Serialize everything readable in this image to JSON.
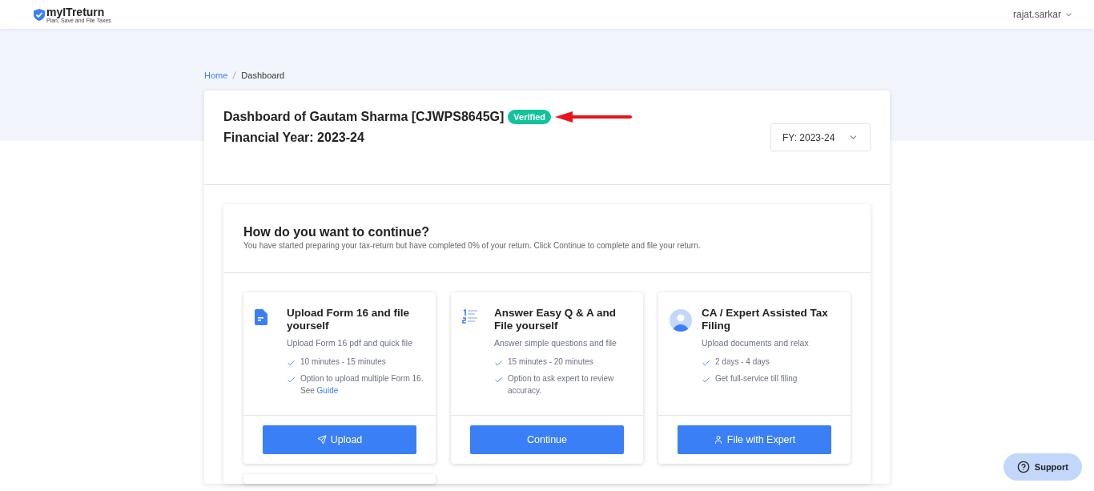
{
  "header": {
    "logo": {
      "name": "myITreturn",
      "tagline": "Plan, Save and File Taxes"
    },
    "user": "rajat.sarkar"
  },
  "breadcrumb": [
    {
      "label": "Home",
      "selected": false
    },
    {
      "label": "Dashboard",
      "selected": true
    }
  ],
  "dashboard": {
    "title": "Dashboard of Gautam Sharma [CJWPS8645G]",
    "badge": "Verified",
    "subtitle": "Financial Year: 2023-24",
    "year_select": "FY: 2023-24"
  },
  "continue": {
    "title": "How do you want to continue?",
    "text": "You have started preparing your tax-return but have completed 0% of your return. Click Continue to complete and file your return.",
    "options": [
      {
        "kind": "document",
        "title": "Upload Form 16 and file yourself",
        "text": "Upload Form 16 pdf and quick file",
        "features": [
          {
            "text": "10 minutes - 15 minutes"
          },
          {
            "text": "Option to upload multiple Form 16. See ",
            "link": "Guide"
          }
        ],
        "button": {
          "label": "Upload",
          "kind": "send"
        }
      },
      {
        "kind": "list",
        "title": "Answer Easy Q & A and File yourself",
        "text": "Answer simple questions and file",
        "features": [
          {
            "text": "15 minutes - 20 minutes"
          },
          {
            "text": "Option to ask expert to review accuracy."
          }
        ],
        "button": {
          "label": "Continue",
          "kind": "plain"
        }
      },
      {
        "kind": "person",
        "title": "CA / Expert Assisted Tax Filing",
        "text": "Upload documents and relax",
        "features": [
          {
            "text": "2 days - 4 days"
          },
          {
            "text": "Get full-service till filing"
          }
        ],
        "button": {
          "label": "File with Expert",
          "kind": "user"
        }
      }
    ]
  },
  "support": "Support"
}
